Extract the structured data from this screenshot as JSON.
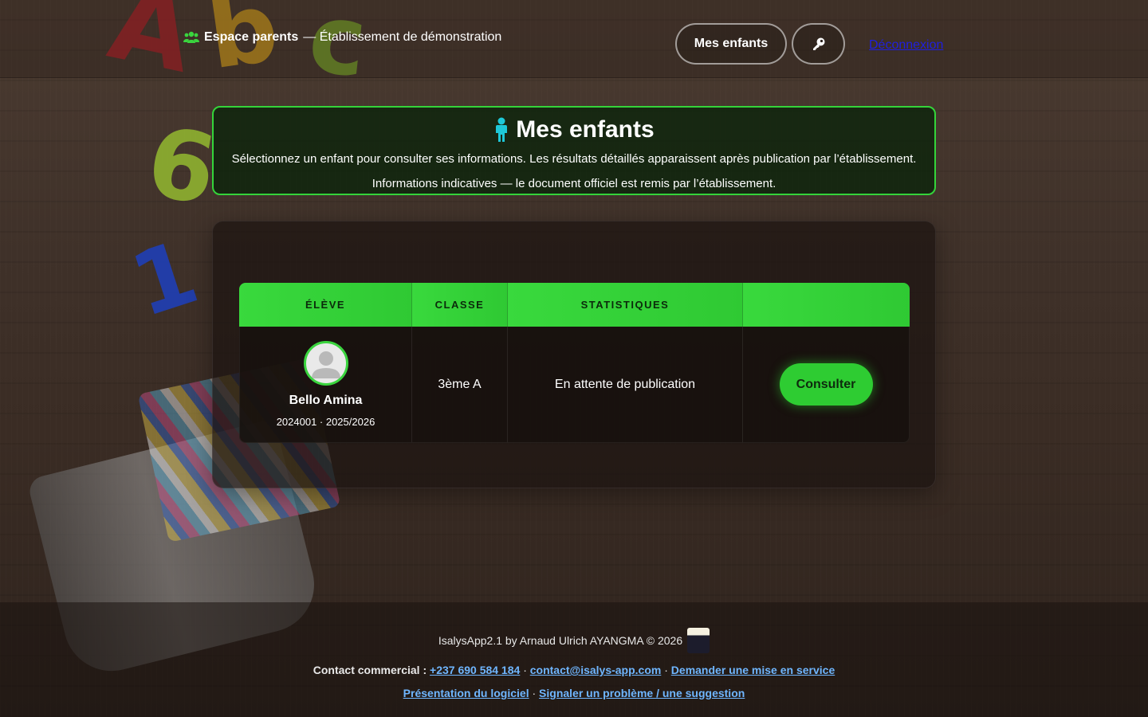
{
  "header": {
    "brand_title": "Espace parents",
    "brand_subtitle": "— Établissement de démonstration",
    "brand_icon": "users-icon",
    "nav": {
      "children_label": "Mes enfants",
      "key_icon": "key-icon",
      "logout_label": "Déconnexion"
    }
  },
  "intro": {
    "icon": "child-icon",
    "title": "Mes enfants",
    "subtitle": "Sélectionnez un enfant pour consulter ses informations. Les résultats détaillés apparaissent après publication par l’établissement.",
    "note": "Informations indicatives — le document officiel est remis par l’établissement."
  },
  "table": {
    "columns": [
      "ÉLÈVE",
      "CLASSE",
      "STATISTIQUES",
      ""
    ],
    "rows": [
      {
        "name": "Bello Amina",
        "meta": "2024001 · 2025/2026",
        "class": "3ème A",
        "stats": "En attente de publication",
        "action": "Consulter"
      }
    ]
  },
  "footer": {
    "credit": "IsalysApp2.1 by Arnaud Ulrich AYANGMA © 2026",
    "contact_label": "Contact commercial :",
    "phone": "+237 690 584 184",
    "email": "contact@isalys-app.com",
    "service_request": "Demander une mise en service",
    "presentation": "Présentation du logiciel",
    "report": "Signaler un problème / une suggestion",
    "separator": "·"
  },
  "colors": {
    "accent_green": "#34d43a",
    "link_blue": "#6fb6ff",
    "logout_blue": "#1f1fe0",
    "child_icon": "#1ec8d8",
    "brand_icon": "#3ad43e"
  }
}
